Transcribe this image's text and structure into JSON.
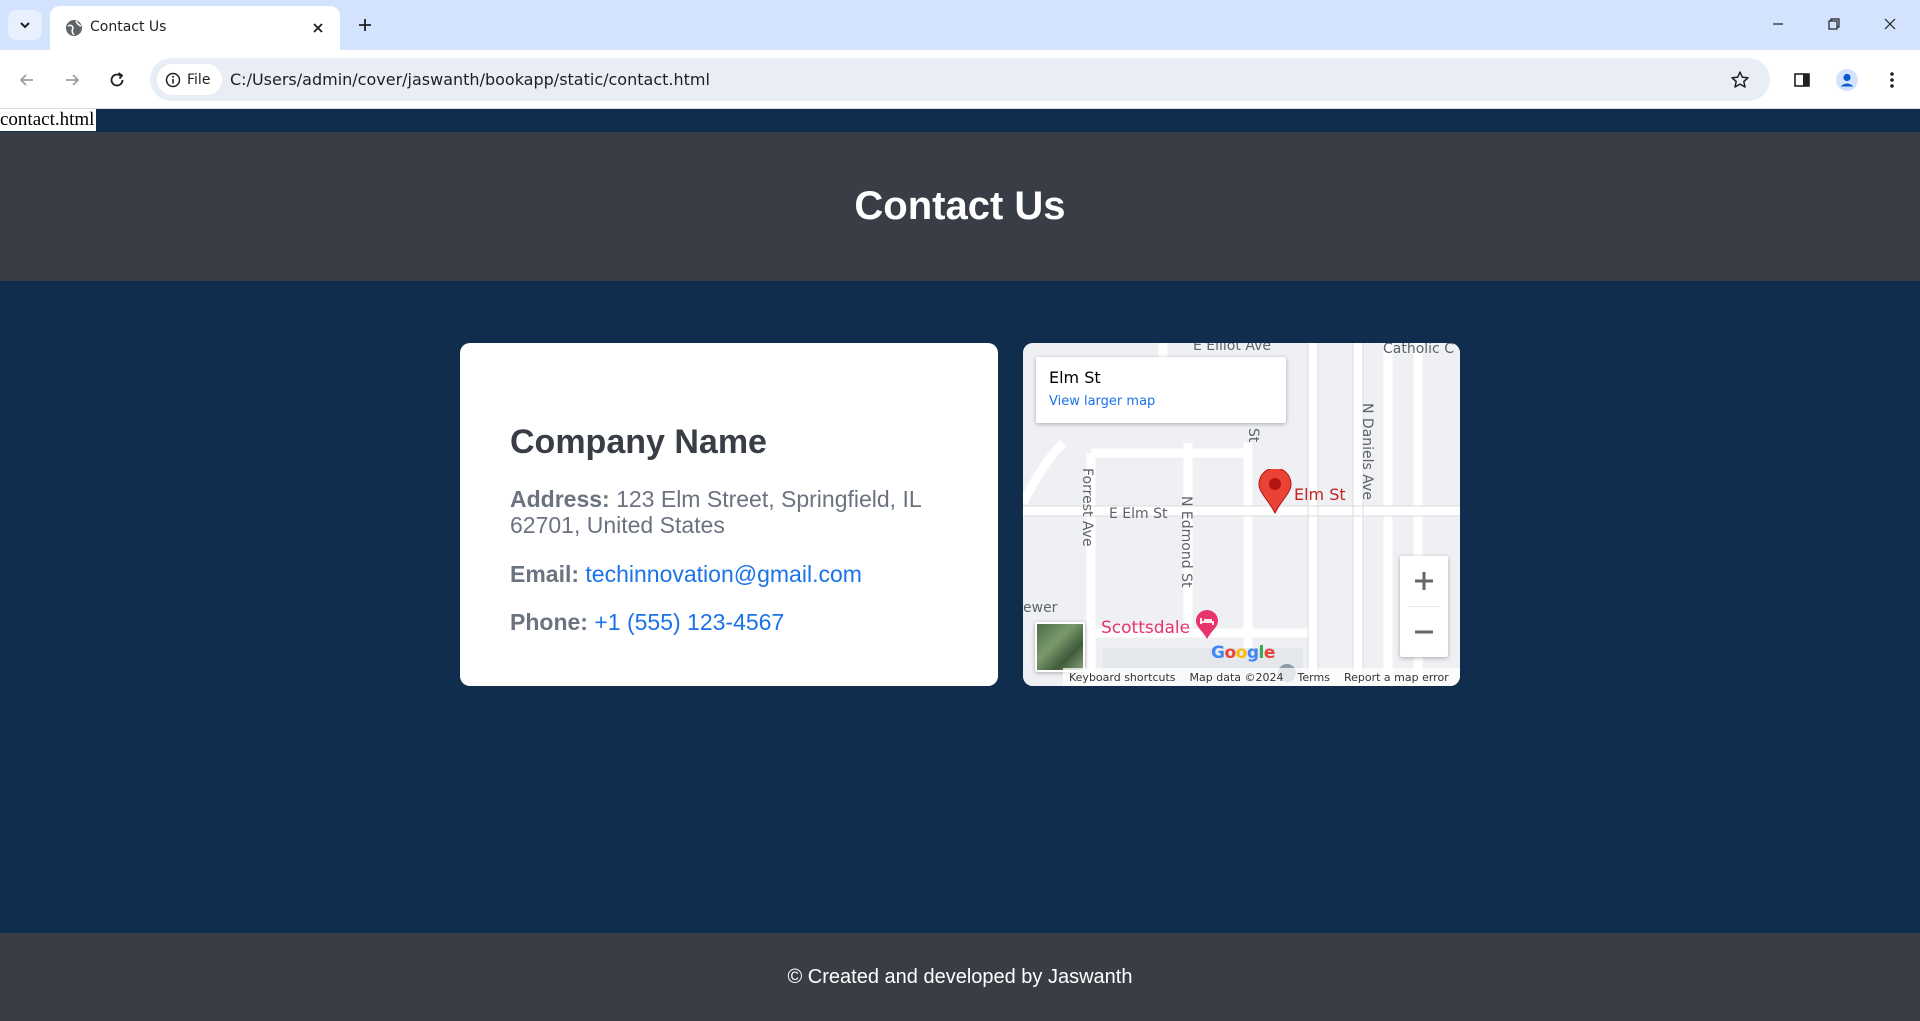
{
  "browser": {
    "tab_title": "Contact Us",
    "site_chip_label": "File",
    "url": "C:/Users/admin/cover/jaswanth/bookapp/static/contact.html"
  },
  "page": {
    "filename_text": "contact.html",
    "title": "Contact Us",
    "company_name": "Company Name",
    "address_label": "Address:",
    "address_value": "123 Elm Street, Springfield, IL 62701, United States",
    "email_label": "Email:",
    "email_value": "techinnovation@gmail.com",
    "phone_label": "Phone:",
    "phone_value": "+1 (555) 123-4567",
    "footer_text": "© Created and developed by Jaswanth"
  },
  "map": {
    "info_title": "Elm St",
    "info_link": "View larger map",
    "pin_label": "Elm St",
    "streets": {
      "elliot": "E Elliot Ave",
      "catholic": "Catholic C",
      "daniels": "N Daniels Ave",
      "st": "St",
      "forrest": "Forrest Ave",
      "e_elm": "E Elm St",
      "edmond": "N Edmond St",
      "ewer": "ewer",
      "scottsdale": "Scottsdale"
    },
    "logo": "Google",
    "footer": {
      "shortcuts": "Keyboard shortcuts",
      "map_data": "Map data ©2024",
      "terms": "Terms",
      "report": "Report a map error"
    }
  },
  "colors": {
    "page_bg": "#112d4e",
    "header_bg": "#393e46",
    "link": "#1a73e8",
    "pin": "#ea4335",
    "poi": "#e8336d"
  }
}
